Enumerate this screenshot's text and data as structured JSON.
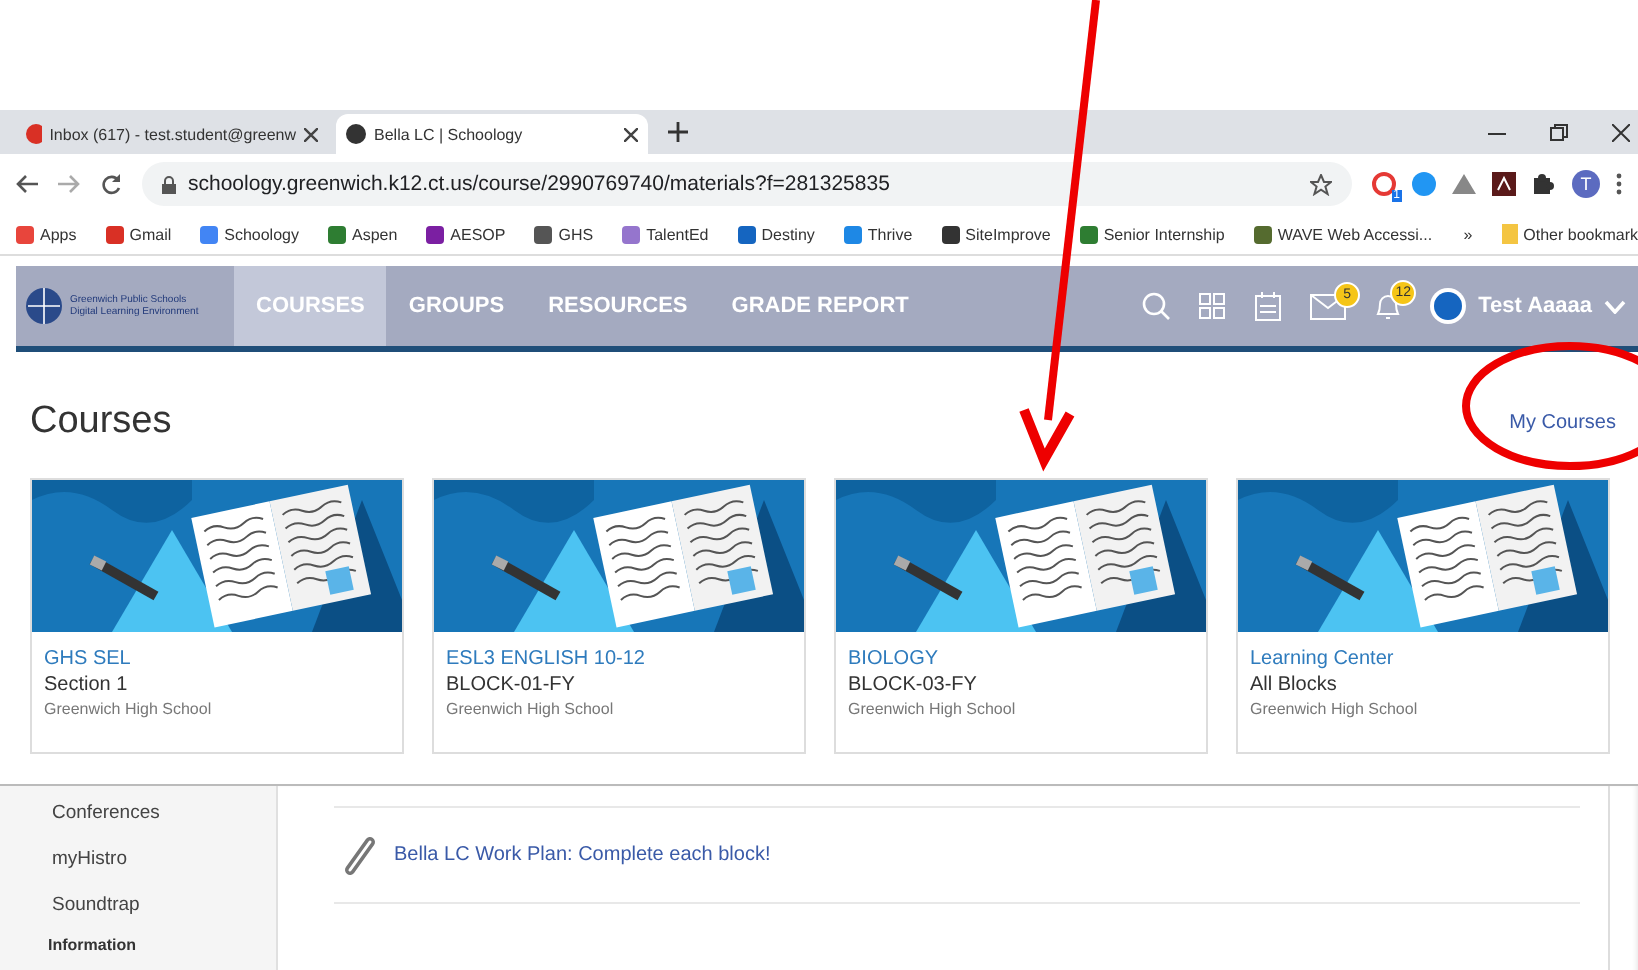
{
  "browser": {
    "tabs": [
      {
        "title": "Inbox (617) - test.student@greenw",
        "selected": false
      },
      {
        "title": "Bella LC | Schoology",
        "selected": true
      }
    ],
    "address": "schoology.greenwich.k12.ct.us/course/2990769740/materials?f=281325835",
    "extension_badge": "1",
    "profile_initial": "T",
    "bookmarks": [
      "Apps",
      "Gmail",
      "Schoology",
      "Aspen",
      "AESOP",
      "GHS",
      "TalentEd",
      "Destiny",
      "Thrive",
      "SiteImprove",
      "Senior Internship",
      "WAVE Web Accessi..."
    ],
    "logo_lines": [
      "Greenwich Public Schools",
      "Digital Learning Environment"
    ],
    "overflow": "»",
    "other_bookmarks": "Other bookmark"
  },
  "nav": {
    "items": [
      {
        "label": "COURSES",
        "selected": true
      },
      {
        "label": "GROUPS",
        "selected": false
      },
      {
        "label": "RESOURCES",
        "selected": false
      },
      {
        "label": "GRADE REPORT",
        "selected": false
      }
    ],
    "message_count": "5",
    "notification_count": "12",
    "user": "Test Aaaaa"
  },
  "courses": {
    "title": "Courses",
    "link": "My Courses",
    "cards": [
      {
        "title": "GHS SEL",
        "section": "Section 1",
        "school": "Greenwich High School"
      },
      {
        "title": "ESL3 ENGLISH 10-12",
        "section": "BLOCK-01-FY",
        "school": "Greenwich High School"
      },
      {
        "title": "BIOLOGY",
        "section": "BLOCK-03-FY",
        "school": "Greenwich High School"
      },
      {
        "title": "Learning Center",
        "section": "All Blocks",
        "school": "Greenwich High School"
      }
    ]
  },
  "sidebar": {
    "items": [
      "Conferences",
      "myHistro",
      "Soundtrap"
    ],
    "heading": "Information"
  },
  "material": {
    "link": "Bella LC Work Plan: Complete each block!"
  }
}
